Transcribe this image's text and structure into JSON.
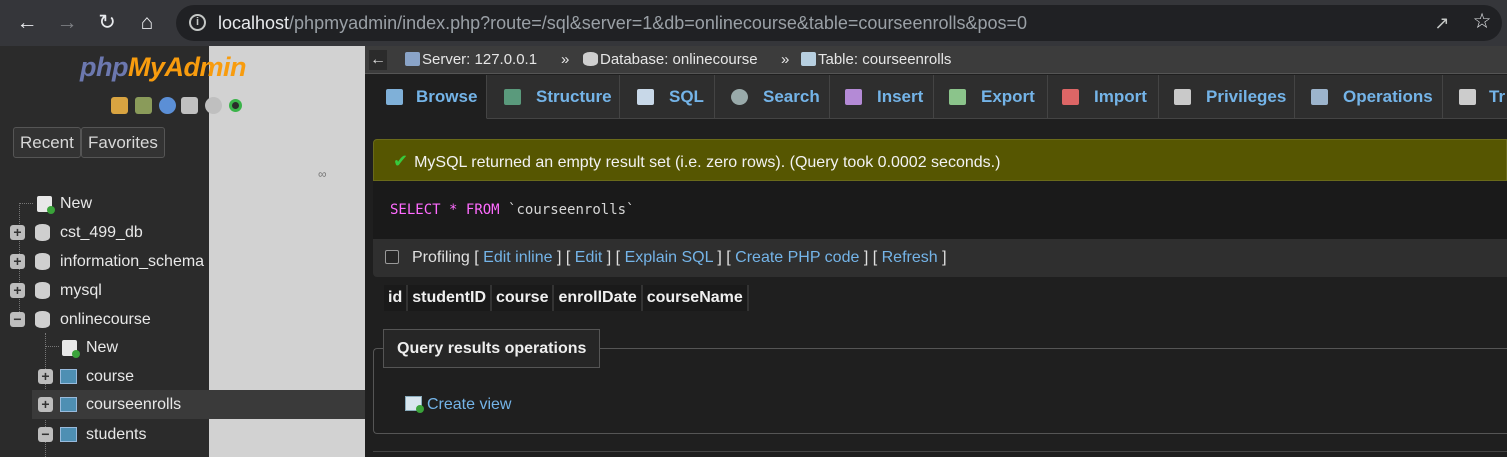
{
  "browser": {
    "url_host": "localhost",
    "url_rest": "/phpmyadmin/index.php?route=/sql&server=1&db=onlinecourse&table=courseenrolls&pos=0",
    "back_icon": "arrow-left-icon",
    "forward_icon": "arrow-right-icon",
    "reload_icon": "reload-icon",
    "home_icon": "home-icon"
  },
  "nav": {
    "logo_php": "php",
    "logo_admin": "MyAdmin",
    "recent_label": "Recent",
    "favorites_label": "Favorites",
    "collapse_label": "∞",
    "tree": [
      {
        "label": "New",
        "type": "new",
        "level": 0
      },
      {
        "label": "cst_499_db",
        "type": "db",
        "level": 0,
        "expander": "+"
      },
      {
        "label": "information_schema",
        "type": "db",
        "level": 0,
        "expander": "+"
      },
      {
        "label": "mysql",
        "type": "db",
        "level": 0,
        "expander": "+"
      },
      {
        "label": "onlinecourse",
        "type": "db",
        "level": 0,
        "expander": "−"
      },
      {
        "label": "New",
        "type": "new",
        "level": 1
      },
      {
        "label": "course",
        "type": "table",
        "level": 1,
        "expander": "+"
      },
      {
        "label": "courseenrolls",
        "type": "table",
        "level": 1,
        "expander": "+",
        "selected": true
      },
      {
        "label": "students",
        "type": "table",
        "level": 1,
        "expander": "−"
      }
    ]
  },
  "breadcrumb": {
    "back": "←",
    "server": "Server: 127.0.0.1",
    "separator": "»",
    "database": "Database: onlinecourse",
    "table": "Table: courseenrolls"
  },
  "tabs": [
    {
      "label": "Browse",
      "icon": "browse-icon",
      "active": true
    },
    {
      "label": "Structure",
      "icon": "structure-icon"
    },
    {
      "label": "SQL",
      "icon": "sql-icon"
    },
    {
      "label": "Search",
      "icon": "search-icon"
    },
    {
      "label": "Insert",
      "icon": "insert-icon"
    },
    {
      "label": "Export",
      "icon": "export-icon"
    },
    {
      "label": "Import",
      "icon": "import-icon"
    },
    {
      "label": "Privileges",
      "icon": "privileges-icon"
    },
    {
      "label": "Operations",
      "icon": "operations-icon"
    },
    {
      "label": "Tr",
      "icon": "tracking-icon"
    }
  ],
  "message": {
    "text": "MySQL returned an empty result set (i.e. zero rows). (Query took 0.0002 seconds.)"
  },
  "query": {
    "select": "SELECT",
    "star": "*",
    "from": "FROM",
    "table": "`courseenrolls`"
  },
  "profiling": {
    "label": "Profiling",
    "edit_inline": "Edit inline",
    "edit": "Edit",
    "explain": "Explain SQL",
    "create_php": "Create PHP code",
    "refresh": "Refresh"
  },
  "result_columns": [
    "id",
    "studentID",
    "course",
    "enrollDate",
    "courseName"
  ],
  "operations": {
    "legend": "Query results operations",
    "create_view": "Create view"
  },
  "colors": {
    "link": "#74b4e8",
    "success_bg": "#565601",
    "logo_php": "#6c78af",
    "logo_admin": "#f89c0e"
  }
}
